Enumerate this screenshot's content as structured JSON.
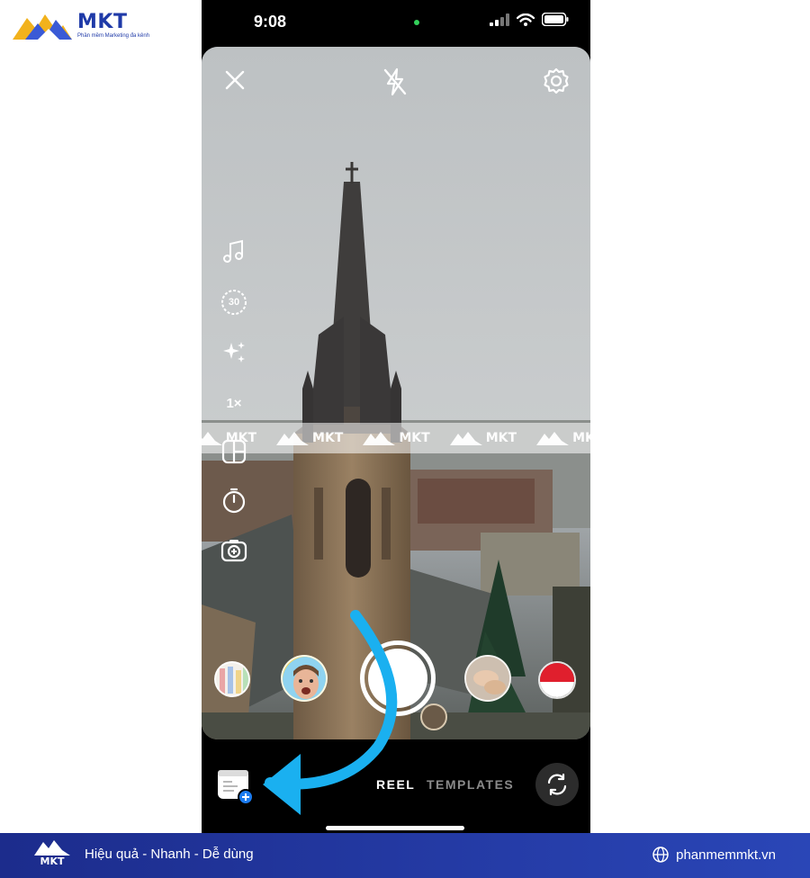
{
  "brand": {
    "name": "MKT",
    "tagline": "Phần mềm Marketing đa kênh",
    "watermark": "MKT"
  },
  "status_bar": {
    "time": "9:08"
  },
  "camera": {
    "close_icon": "close-icon",
    "flash_icon": "flash-off-icon",
    "settings_icon": "settings-icon",
    "tools": {
      "music_icon": "music-note-icon",
      "length_label": "30",
      "effects_icon": "sparkles-icon",
      "speed_label": "1×",
      "layout_icon": "layout-icon",
      "timer_icon": "timer-icon",
      "dual_icon": "dual-camera-icon"
    }
  },
  "bottom": {
    "mode_active": "REEL",
    "mode_other": "TEMPLATES",
    "flip_icon": "flip-camera-icon",
    "gallery_icon": "gallery-add-icon"
  },
  "footer": {
    "logo": "MKT",
    "slogan": "Hiệu quả - Nhanh - Dễ dùng",
    "website": "phanmemmkt.vn"
  },
  "colors": {
    "brand_blue": "#1f3aa8",
    "arrow_blue": "#1ab0f0",
    "footer_left": "#1c2c8c",
    "footer_right": "#2a46b7"
  }
}
